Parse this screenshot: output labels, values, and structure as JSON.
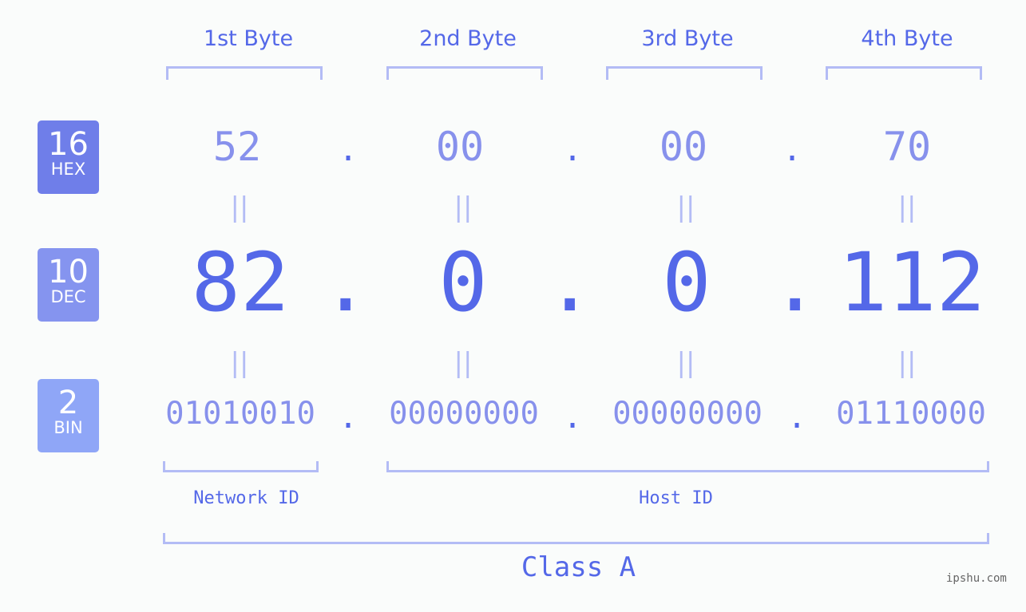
{
  "headers": [
    "1st Byte",
    "2nd Byte",
    "3rd Byte",
    "4th Byte"
  ],
  "badges": [
    {
      "base": "16",
      "label": "HEX",
      "color": "#6f7ee9"
    },
    {
      "base": "10",
      "label": "DEC",
      "color": "#8594ef"
    },
    {
      "base": "2",
      "label": "BIN",
      "color": "#8fa6f7"
    }
  ],
  "hex": [
    "52",
    "00",
    "00",
    "70"
  ],
  "dec": [
    "82",
    "0",
    "0",
    "112"
  ],
  "bin": [
    "01010010",
    "00000000",
    "00000000",
    "01110000"
  ],
  "separator": ".",
  "equals": "||",
  "network_label": "Network ID",
  "host_label": "Host ID",
  "class_label": "Class A",
  "watermark": "ipshu.com"
}
